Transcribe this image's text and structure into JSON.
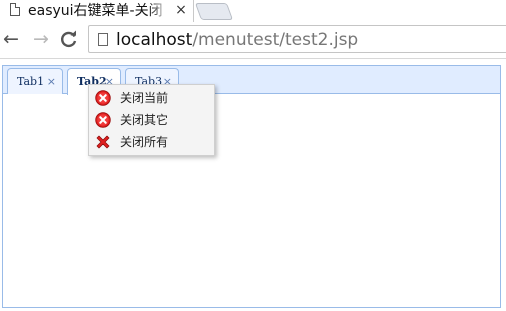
{
  "browser": {
    "tab_title": "easyui右键菜单-关闭",
    "tab_close": "×",
    "url_host": "localhost",
    "url_path": "/menutest/test2.jsp",
    "back_glyph": "←",
    "forward_glyph": "→",
    "reload_glyph": "C"
  },
  "tabs": {
    "items": [
      {
        "label": "Tab1",
        "close": "×"
      },
      {
        "label": "Tab2",
        "close": "×"
      },
      {
        "label": "Tab3",
        "close": "×"
      }
    ],
    "selected_index": 1
  },
  "context_menu": {
    "items": [
      {
        "label": "关闭当前",
        "icon": "close-circle-icon"
      },
      {
        "label": "关闭其它",
        "icon": "close-circle-icon"
      },
      {
        "label": "关闭所有",
        "icon": "red-x-icon"
      }
    ]
  },
  "colors": {
    "tabs_border": "#99bbe8",
    "tabs_header_bg": "#e0ecff",
    "close_red": "#e02020"
  }
}
